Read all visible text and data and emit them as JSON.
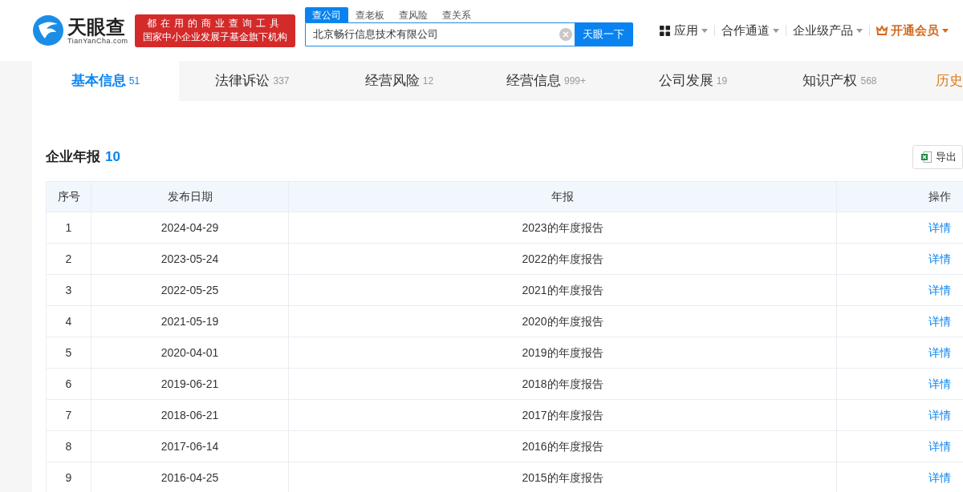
{
  "logo": {
    "name": "天眼查",
    "domain": "TianYanCha.com"
  },
  "slogan": [
    "都在用的商业查询工具",
    "国家中小企业发展子基金旗下机构"
  ],
  "search": {
    "tabs": [
      {
        "label": "查公司",
        "selected": true
      },
      {
        "label": "查老板",
        "selected": false
      },
      {
        "label": "查风险",
        "selected": false
      },
      {
        "label": "查关系",
        "selected": false
      }
    ],
    "value": "北京畅行信息技术有限公司",
    "button": "天眼一下"
  },
  "nav": [
    {
      "label": "应用",
      "kind": "apps"
    },
    {
      "label": "合作通道",
      "kind": "plain"
    },
    {
      "label": "企业级产品",
      "kind": "plain"
    },
    {
      "label": "开通会员",
      "kind": "vip"
    }
  ],
  "tabs": [
    {
      "label": "基本信息",
      "count": "51",
      "selected": true
    },
    {
      "label": "法律诉讼",
      "count": "337",
      "selected": false
    },
    {
      "label": "经营风险",
      "count": "12",
      "selected": false
    },
    {
      "label": "经营信息",
      "count": "999+",
      "selected": false
    },
    {
      "label": "公司发展",
      "count": "19",
      "selected": false
    },
    {
      "label": "知识产权",
      "count": "568",
      "selected": false
    },
    {
      "label": "历史",
      "selected": false,
      "kind": "history"
    }
  ],
  "section": {
    "title": "企业年报",
    "count": "10",
    "export": "导出"
  },
  "table": {
    "columns": [
      "序号",
      "发布日期",
      "年报",
      "操作"
    ],
    "rows": [
      {
        "no": "1",
        "date": "2024-04-29",
        "report": "2023的年度报告",
        "action": "详情"
      },
      {
        "no": "2",
        "date": "2023-05-24",
        "report": "2022的年度报告",
        "action": "详情"
      },
      {
        "no": "3",
        "date": "2022-05-25",
        "report": "2021的年度报告",
        "action": "详情"
      },
      {
        "no": "4",
        "date": "2021-05-19",
        "report": "2020的年度报告",
        "action": "详情"
      },
      {
        "no": "5",
        "date": "2020-04-01",
        "report": "2019的年度报告",
        "action": "详情"
      },
      {
        "no": "6",
        "date": "2019-06-21",
        "report": "2018的年度报告",
        "action": "详情"
      },
      {
        "no": "7",
        "date": "2018-06-21",
        "report": "2017的年度报告",
        "action": "详情"
      },
      {
        "no": "8",
        "date": "2017-06-14",
        "report": "2016的年度报告",
        "action": "详情"
      },
      {
        "no": "9",
        "date": "2016-04-25",
        "report": "2015的年度报告",
        "action": "详情"
      }
    ]
  }
}
